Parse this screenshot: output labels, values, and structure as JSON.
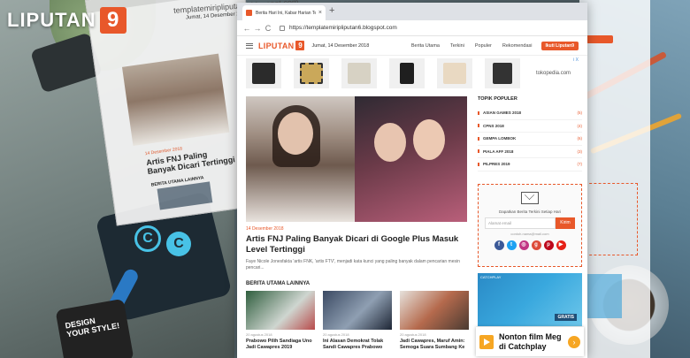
{
  "brand": {
    "logo_text": "LIPUTAN",
    "logo_number": "9"
  },
  "back_window": {
    "url": "templatemiripliputan6.blogspot.com",
    "date": "Jumat, 14 Desember 2018",
    "date_small": "14 Desember 2018",
    "title": "Artis FNJ Paling Banyak Dicari Tertinggi",
    "section": "BERITA UTAMA LAINNYA"
  },
  "browser": {
    "tab_title": "Berita Hari Ini, Kabar Harian Terkini",
    "tab_close": "×",
    "new_tab": "+",
    "url": "https://templatemiripliputan6.blogspot.com",
    "back": "←",
    "forward": "→",
    "reload": "C"
  },
  "site": {
    "logo_text": "LIPUTAN",
    "logo_number": "9",
    "date": "Jumat, 14 Desember 2018",
    "nav": [
      "Berita Utama",
      "Terkini",
      "Populer",
      "Rekomendasi"
    ],
    "login": "Ikuti Liputan9"
  },
  "ad_strip": {
    "source": "tokopedia.com",
    "info": "i X"
  },
  "hero": {
    "date": "14 Desember 2018",
    "title": "Artis FNJ Paling Banyak Dicari di Google Plus Masuk Level Tertinggi",
    "excerpt": "Faye Nicole Jonesfakta 'artis FNK, 'artis FTV', menjadi kata kunci yang paling banyak dalam pencarian mesin pencari..."
  },
  "related_section": "BERITA UTAMA LAINNYA",
  "related": [
    {
      "date": "20 agustus 2018",
      "title": "Prabowo Pilih Sandiaga Uno Jadi Cawapres 2019"
    },
    {
      "date": "20 agustus 2018",
      "title": "Ini Alasan Demokrat Tolak Sandi Cawapres Prabowo"
    },
    {
      "date": "20 agustus 2018",
      "title": "Jadi Cawapres, Maruf Amin: Semoga Suara Sumbang Ke"
    }
  ],
  "sidebar": {
    "heading": "TOPIK POPULER",
    "topics": [
      {
        "name": "ASIAN GAMES 2018",
        "count": "(5)"
      },
      {
        "name": "CPNS 2018",
        "count": "(4)"
      },
      {
        "name": "GEMPA LOMBOK",
        "count": "(6)"
      },
      {
        "name": "PIALA AFF 2018",
        "count": "(3)"
      },
      {
        "name": "PILPRES 2019",
        "count": "(7)"
      }
    ],
    "subscribe_text": "Dapatkan Berita Terkini Setiap Hari",
    "subscribe_placeholder": "Alamat email",
    "subscribe_button": "Kirim",
    "subscribe_email": "contoh.nama@mail.com",
    "ad_label": "CATCHPLAY",
    "ad_brand": "GRATIS"
  },
  "catch_ad": {
    "text": "Nonton film Meg di Catchplay",
    "arrow": "›"
  },
  "bg_phone": "DESIGN YOUR STYLE!",
  "bg_letters": [
    "C",
    "C"
  ]
}
